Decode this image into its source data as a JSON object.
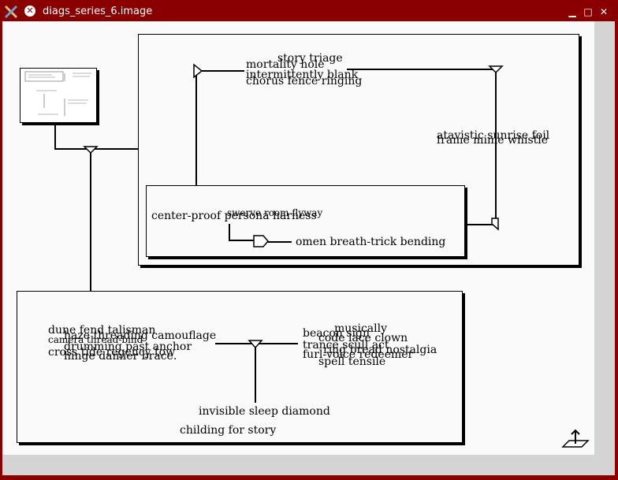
{
  "window": {
    "title": "diags_series_6.image",
    "buttons": {
      "minimize": "▁",
      "maximize": "□",
      "close": "✕"
    }
  },
  "icons": {
    "app": "app-logo-icon",
    "close": "close-circle-icon",
    "export": "export-icon"
  },
  "colors": {
    "titlebar": "#8a0000",
    "canvas": "#fafafa",
    "border": "#d4d4d4"
  },
  "diagram": {
    "top_box": {
      "labels": {
        "story_triage": "story triage",
        "mortality_hole": "mortality hole",
        "intermittently_blank": "intermittently blank",
        "chorus_fence_ringing": "chorus fence ringing",
        "atavistic_sunrise_foil": "atavistic sunrise foil",
        "frame_mime_whistle": "frame mime whistle"
      },
      "inner_box": {
        "labels": {
          "swerve_room_flyway": "swerve room flyway",
          "center_proof_persona_harness": "center-proof persona harness",
          "omen_breath_trick_bending": "omen breath-trick bending"
        }
      }
    },
    "bottom_box": {
      "labels": {
        "dune_fend_talisman": "dune fend talisman",
        "haze_threading_camouflage": "haze threading camouflage",
        "camera_thread_bind": "camera thread-bind",
        "drumming_past_anchor": "drumming past anchor",
        "cross_tide_regency_tow": "cross tide regency tow",
        "hinge_damier_brace": "hinge damier brace.",
        "musically": "musically",
        "beacon_sign": "beacon sign",
        "code_lace_clown": "code lace clown",
        "trance_scull_act": "trance scull act",
        "ring_bread_nostalgia": "ring bread nostalgia",
        "furl_voice_redeemer": "furl-voice redeemer",
        "spell_tensile": "spell tensile",
        "invisible_sleep_diamond": "invisible sleep diamond",
        "childing_for_story": "childing for story"
      }
    }
  }
}
